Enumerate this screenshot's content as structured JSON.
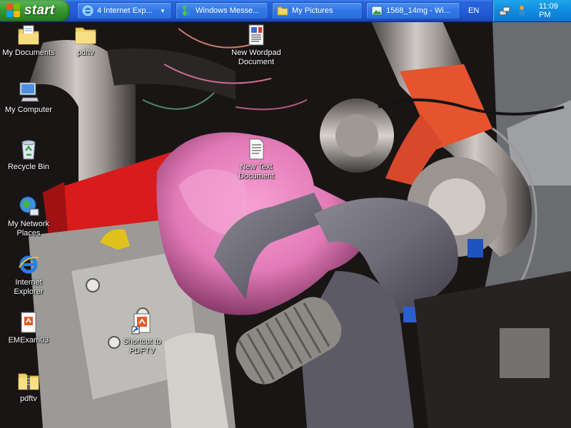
{
  "taskbar": {
    "start_label": "start",
    "buttons": [
      {
        "label": "4 Internet Exp...",
        "icon": "internet-explorer-icon",
        "has_arrow": true
      },
      {
        "label": "Windows Messe...",
        "icon": "windows-messenger-icon",
        "has_arrow": false
      },
      {
        "label": "My Pictures",
        "icon": "folder-icon",
        "has_arrow": false
      },
      {
        "label": "1568_14mg - Wi...",
        "icon": "image-viewer-icon",
        "has_arrow": false
      }
    ],
    "language": "EN",
    "tray": {
      "icons": [
        "network-icon",
        "messenger-status-icon"
      ],
      "clock": "11:09 PM"
    }
  },
  "desktop": {
    "icons": [
      {
        "label": "My Documents",
        "icon": "my-documents-icon"
      },
      {
        "label": "pdftv",
        "icon": "folder-icon"
      },
      {
        "label": "New Wordpad Document",
        "icon": "wordpad-document-icon"
      },
      {
        "label": "My Computer",
        "icon": "my-computer-icon"
      },
      {
        "label": "Recycle Bin",
        "icon": "recycle-bin-icon"
      },
      {
        "label": "New Text Document",
        "icon": "text-document-icon"
      },
      {
        "label": "My Network Places",
        "icon": "network-places-icon"
      },
      {
        "label": "Internet Explorer",
        "icon": "internet-explorer-icon"
      },
      {
        "label": "EMExam03",
        "icon": "document-icon"
      },
      {
        "label": "Shortcut to PDFTV",
        "icon": "shortcut-icon"
      },
      {
        "label": "pdftv",
        "icon": "zip-folder-icon"
      }
    ]
  },
  "colors": {
    "taskbar": "#245edb",
    "start": "#3c9c36",
    "tray": "#0f8ce0"
  }
}
